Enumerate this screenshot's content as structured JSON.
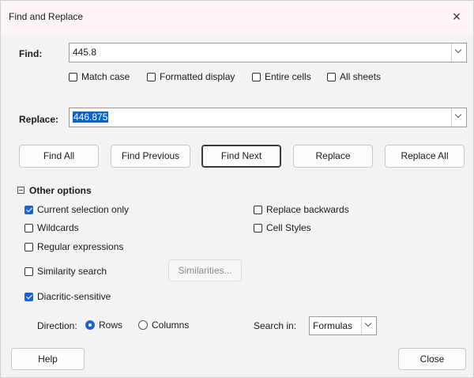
{
  "window": {
    "title": "Find and Replace",
    "close_glyph": "×"
  },
  "find": {
    "label": "Find:",
    "value": "445.8"
  },
  "replace": {
    "label": "Replace:",
    "value": "446.875"
  },
  "find_options": [
    {
      "label": "Match case",
      "checked": false
    },
    {
      "label": "Formatted display",
      "checked": false
    },
    {
      "label": "Entire cells",
      "checked": false
    },
    {
      "label": "All sheets",
      "checked": false
    }
  ],
  "buttons": {
    "find_all": "Find All",
    "find_previous": "Find Previous",
    "find_next": "Find Next",
    "replace": "Replace",
    "replace_all": "Replace All"
  },
  "other_options": {
    "label": "Other options",
    "current_selection_only": {
      "label": "Current selection only",
      "checked": true
    },
    "wildcards": {
      "label": "Wildcards",
      "checked": false
    },
    "regular_expressions": {
      "label": "Regular expressions",
      "checked": false
    },
    "similarity_search": {
      "label": "Similarity search",
      "checked": false
    },
    "similarities_button": "Similarities...",
    "diacritic_sensitive": {
      "label": "Diacritic-sensitive",
      "checked": true
    },
    "replace_backwards": {
      "label": "Replace backwards",
      "checked": false
    },
    "cell_styles": {
      "label": "Cell Styles",
      "checked": false
    }
  },
  "direction": {
    "label": "Direction:",
    "rows": {
      "label": "Rows",
      "selected": true
    },
    "columns": {
      "label": "Columns",
      "selected": false
    }
  },
  "search_in": {
    "label": "Search in:",
    "value": "Formulas"
  },
  "footer": {
    "help": "Help",
    "close": "Close"
  },
  "colors": {
    "accent": "#1f63c8",
    "selection": "#0a64c8",
    "titlebar": "#fdf5f5"
  },
  "icons": {
    "close": "close-icon",
    "dropdown": "chevron-down-icon",
    "collapse": "minus-box-icon"
  }
}
